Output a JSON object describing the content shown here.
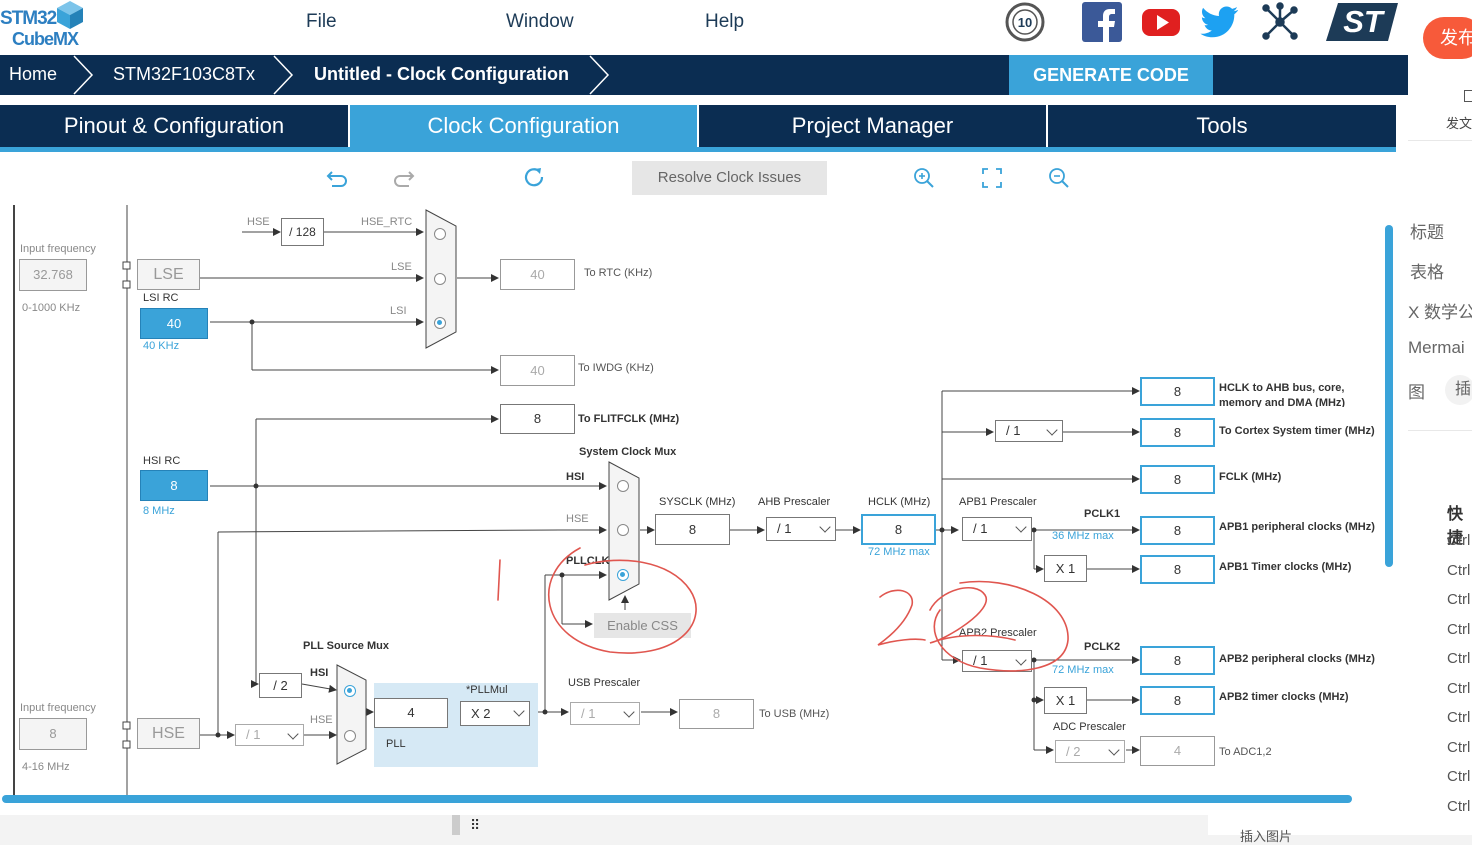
{
  "app": {
    "logo_line1": "STM32",
    "logo_line2": "CubeMX"
  },
  "menu": {
    "file": "File",
    "window": "Window",
    "help": "Help"
  },
  "social_icons": [
    "anniversary-10-icon",
    "facebook-icon",
    "youtube-icon",
    "twitter-icon",
    "network-icon",
    "st-logo"
  ],
  "anniversary_badge": "10",
  "st_logo_text": "ST",
  "breadcrumb": {
    "home": "Home",
    "device": "STM32F103C8Tx",
    "current": "Untitled - Clock Configuration"
  },
  "generate_button": "GENERATE CODE",
  "tabs": [
    {
      "label": "Pinout & Configuration",
      "active": false
    },
    {
      "label": "Clock Configuration",
      "active": true
    },
    {
      "label": "Project Manager",
      "active": false
    },
    {
      "label": "Tools",
      "active": false
    }
  ],
  "toolbar": {
    "resolve_label": "Resolve Clock Issues",
    "icons": [
      "undo-icon",
      "redo-icon",
      "refresh-icon",
      "zoom-in-icon",
      "fit-screen-icon",
      "zoom-out-icon"
    ]
  },
  "clock": {
    "lse_input": {
      "label": "Input frequency",
      "value": "32.768",
      "range": "0-1000 KHz"
    },
    "lse_label": "LSE",
    "lsi": {
      "title": "LSI RC",
      "value": "40",
      "unit": "40 KHz"
    },
    "hse_div128": "/ 128",
    "rtc_mux_labels": {
      "hse": "HSE",
      "hse_rtc": "HSE_RTC",
      "lse": "LSE",
      "lsi": "LSI"
    },
    "rtc": {
      "value": "40",
      "label": "To RTC (KHz)"
    },
    "iwdg": {
      "value": "40",
      "label": "To IWDG (KHz)"
    },
    "flitf": {
      "value": "8",
      "label": "To FLITFCLK (MHz)"
    },
    "hsi": {
      "title": "HSI RC",
      "value": "8",
      "unit": "8 MHz"
    },
    "sysmux": {
      "title": "System Clock Mux",
      "hsi": "HSI",
      "hse": "HSE",
      "pllclk": "PLLCLK"
    },
    "enable_css": "Enable CSS",
    "sysclk": {
      "title": "SYSCLK (MHz)",
      "value": "8"
    },
    "ahb": {
      "title": "AHB Prescaler",
      "value": "/ 1"
    },
    "hclk": {
      "title": "HCLK (MHz)",
      "value": "8",
      "max": "72 MHz max"
    },
    "apb1": {
      "title": "APB1 Prescaler",
      "value": "/ 1",
      "pclk": "PCLK1",
      "max": "36 MHz max",
      "timer_mult": "X 1"
    },
    "apb2": {
      "title": "APB2 Prescaler",
      "value": "/ 1",
      "pclk": "PCLK2",
      "max": "72 MHz max",
      "timer_mult": "X 1"
    },
    "cortex_div": "/ 1",
    "adc": {
      "title": "ADC Prescaler",
      "value": "/ 2",
      "out": "4",
      "label": "To ADC1,2"
    },
    "outputs": [
      {
        "value": "8",
        "label": "HCLK to AHB bus, core, memory and DMA (MHz)"
      },
      {
        "value": "8",
        "label": "To Cortex System timer (MHz)"
      },
      {
        "value": "8",
        "label": "FCLK (MHz)"
      },
      {
        "value": "8",
        "label": "APB1 peripheral clocks (MHz)"
      },
      {
        "value": "8",
        "label": "APB1 Timer clocks (MHz)"
      },
      {
        "value": "8",
        "label": "APB2 peripheral clocks (MHz)"
      },
      {
        "value": "8",
        "label": "APB2 timer clocks (MHz)"
      }
    ],
    "pll": {
      "source_title": "PLL Source Mux",
      "hsi": "HSI",
      "hse": "HSE",
      "hsi_div": "/ 2",
      "value": "4",
      "mul_title": "*PLLMul",
      "mul": "X 2",
      "label": "PLL"
    },
    "usb": {
      "title": "USB Prescaler",
      "value": "/ 1",
      "out": "8",
      "label": "To USB (MHz)"
    },
    "hse_input": {
      "label": "Input frequency",
      "value": "8",
      "range": "4-16 MHz"
    },
    "hse_label": "HSE",
    "hse_div": "/ 1"
  },
  "annotations": {
    "mark1": "1",
    "mark2": "2"
  },
  "side_panel": {
    "publish": "发布",
    "draft": "发文",
    "items": [
      "标题",
      "表格",
      "X 数学公",
      "Mermai",
      "图",
      "插"
    ],
    "shortcuts_title": "快捷",
    "shortcut_prefix": "Ctrl",
    "shortcut_count": 10,
    "insert_image": "插入图片"
  },
  "colors": {
    "navy": "#0b2d52",
    "accent": "#3aa3d9",
    "publish": "#f75a3a",
    "annotation": "#e0564f"
  }
}
